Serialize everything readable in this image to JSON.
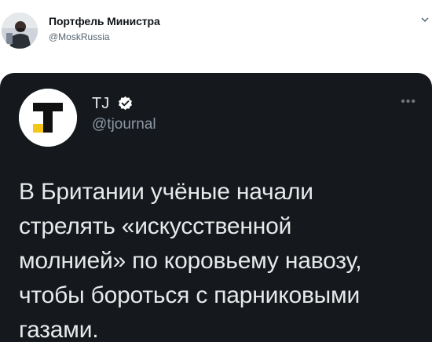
{
  "outer_tweet": {
    "display_name": "Портфель Министра",
    "handle": "@MoskRussia"
  },
  "quoted_tweet": {
    "display_name": "TJ",
    "handle": "@tjournal",
    "text": "В Британии учёные начали\nстрелять «искусственной\nмолнией» по коровьему навозу,\nчтобы бороться с парниковыми\nгазами."
  },
  "icons": {
    "verified": "verified-badge-icon",
    "more": "more-options-icon",
    "chevron": "chevron-down-icon"
  },
  "colors": {
    "card_background": "#15181c",
    "verified_badge": "#ffffff",
    "logo_accent": "#f5c518"
  }
}
